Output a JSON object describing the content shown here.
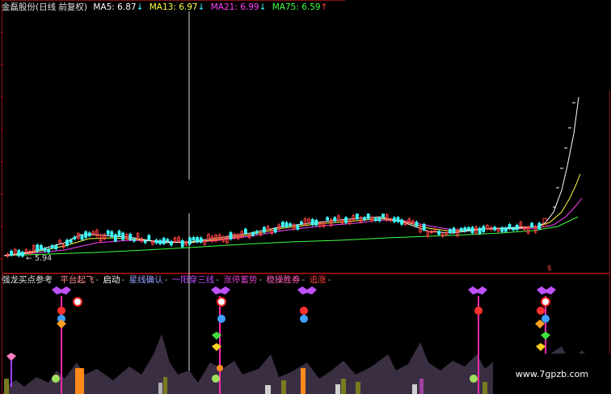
{
  "header": {
    "stock_name": "金磊股份(日线 前复权)",
    "ma5": "MA5: 6.87",
    "ma5_arrow": "↓",
    "ma13": "MA13: 6.97",
    "ma13_arrow": "↓",
    "ma21": "MA21: 6.99",
    "ma21_arrow": "↓",
    "ma75": "MA75: 6.59",
    "ma75_arrow": "↑"
  },
  "low_label": "← 5.94",
  "indicator": {
    "title": "强龙买点参考",
    "items": [
      {
        "label": "平台起飞",
        "color": "#ff9090"
      },
      {
        "label": "启动",
        "color": "#ffffff"
      },
      {
        "label": "星线确认",
        "color": "#9aa0ff"
      },
      {
        "label": "一阳穿三线",
        "color": "#c050ff"
      },
      {
        "label": "涨停蓄势",
        "color": "#d040c0"
      },
      {
        "label": "稳操胜券",
        "color": "#ff60c0"
      },
      {
        "label": "追涨",
        "color": "#ff4040"
      }
    ],
    "separator": "-"
  },
  "watermark": "www.7gpzb.com",
  "colors": {
    "ma5": "#ffffff",
    "ma13": "#ffff40",
    "ma21": "#ff40ff",
    "ma75": "#40ff40",
    "up": "#ff4040",
    "down": "#40ffff",
    "border": "#a01010"
  }
}
